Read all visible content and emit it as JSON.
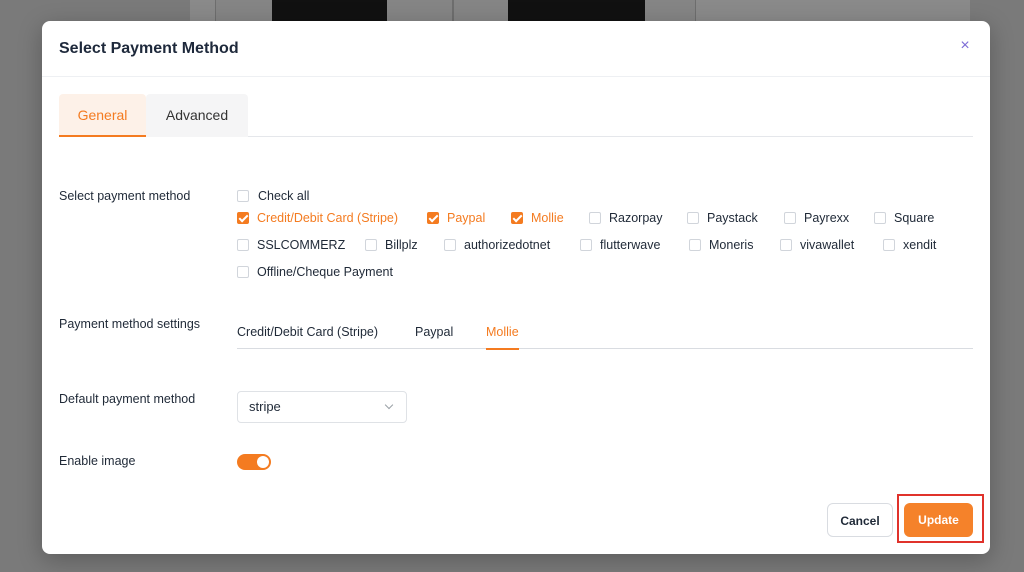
{
  "modal": {
    "title": "Select Payment Method",
    "close_symbol": "×"
  },
  "tabs": [
    {
      "label": "General",
      "active": true
    },
    {
      "label": "Advanced",
      "active": false
    }
  ],
  "payment_method": {
    "label": "Select payment method",
    "check_all": "Check all",
    "options": [
      {
        "label": "Credit/Debit Card (Stripe)",
        "checked": true
      },
      {
        "label": "Paypal",
        "checked": true
      },
      {
        "label": "Mollie",
        "checked": true
      },
      {
        "label": "Razorpay",
        "checked": false
      },
      {
        "label": "Paystack",
        "checked": false
      },
      {
        "label": "Payrexx",
        "checked": false
      },
      {
        "label": "Square",
        "checked": false
      },
      {
        "label": "SSLCOMMERZ",
        "checked": false
      },
      {
        "label": "Billplz",
        "checked": false
      },
      {
        "label": "authorizedotnet",
        "checked": false
      },
      {
        "label": "flutterwave",
        "checked": false
      },
      {
        "label": "Moneris",
        "checked": false
      },
      {
        "label": "vivawallet",
        "checked": false
      },
      {
        "label": "xendit",
        "checked": false
      },
      {
        "label": "Offline/Cheque Payment",
        "checked": false
      }
    ]
  },
  "settings": {
    "label": "Payment method settings",
    "tabs": [
      {
        "label": "Credit/Debit Card (Stripe)",
        "active": false
      },
      {
        "label": "Paypal",
        "active": false
      },
      {
        "label": "Mollie",
        "active": true
      }
    ]
  },
  "default_method": {
    "label": "Default payment method",
    "value": "stripe"
  },
  "enable_image": {
    "label": "Enable image",
    "on": true
  },
  "buttons": {
    "cancel": "Cancel",
    "update": "Update"
  },
  "colors": {
    "accent": "#f47b20",
    "highlight": "#e0322b"
  }
}
